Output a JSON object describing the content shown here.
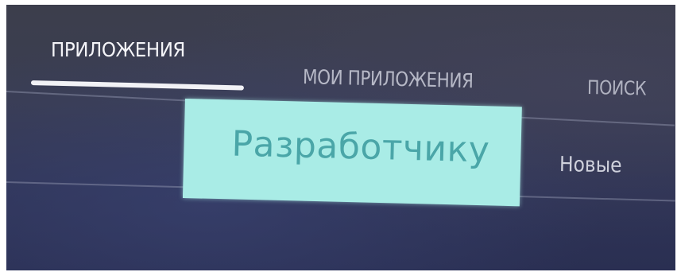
{
  "tabs": {
    "apps": "ПРИЛОЖЕНИЯ",
    "my_apps": "МОИ ПРИЛОЖЕНИЯ",
    "search": "ПОИСК"
  },
  "categories": {
    "selected": "Разработчику",
    "new": "Новые"
  },
  "colors": {
    "background": "#33375a",
    "selected_tile": "#a9ece6",
    "selected_text": "#4aa6a8",
    "active_tab_text": "#f4f4f8",
    "inactive_tab_text": "#b6b8c6"
  }
}
